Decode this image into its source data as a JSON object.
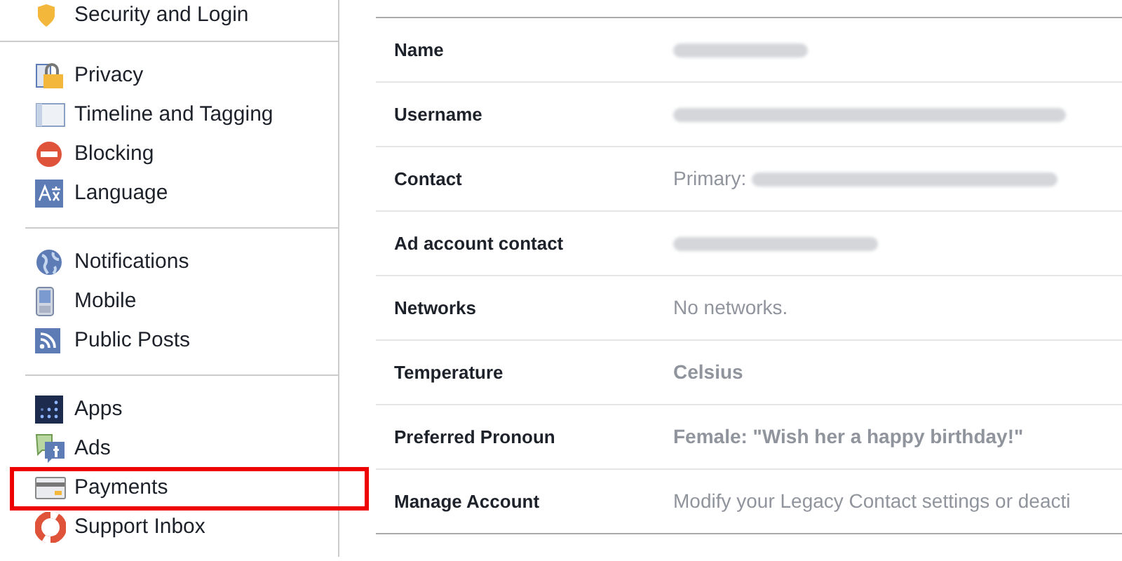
{
  "sidebar": {
    "sections": [
      {
        "items": [
          {
            "label": "Security and Login",
            "outlined": false
          }
        ]
      },
      {
        "items": [
          {
            "label": "Privacy",
            "outlined": false
          },
          {
            "label": "Timeline and Tagging",
            "outlined": false
          },
          {
            "label": "Blocking",
            "outlined": false
          },
          {
            "label": "Language",
            "outlined": false
          }
        ]
      },
      {
        "items": [
          {
            "label": "Notifications",
            "outlined": false
          },
          {
            "label": "Mobile",
            "outlined": false
          },
          {
            "label": "Public Posts",
            "outlined": false
          }
        ]
      },
      {
        "items": [
          {
            "label": "Apps",
            "outlined": false
          },
          {
            "label": "Ads",
            "outlined": false
          },
          {
            "label": "Payments",
            "outlined": true
          },
          {
            "label": "Support Inbox",
            "outlined": false
          }
        ]
      }
    ]
  },
  "settings": {
    "rows": [
      {
        "label": "Name",
        "kind": "redacted"
      },
      {
        "label": "Username",
        "kind": "redacted"
      },
      {
        "label": "Contact",
        "prefix": "Primary:",
        "kind": "redacted"
      },
      {
        "label": "Ad account contact",
        "kind": "redacted"
      },
      {
        "label": "Networks",
        "value": "No networks.",
        "kind": "plain"
      },
      {
        "label": "Temperature",
        "value": "Celsius",
        "kind": "bold"
      },
      {
        "label": "Preferred Pronoun",
        "value": "Female: \"Wish her a happy birthday!\"",
        "kind": "bold"
      },
      {
        "label": "Manage Account",
        "value": "Modify your Legacy Contact settings or deacti",
        "kind": "plain"
      }
    ]
  }
}
